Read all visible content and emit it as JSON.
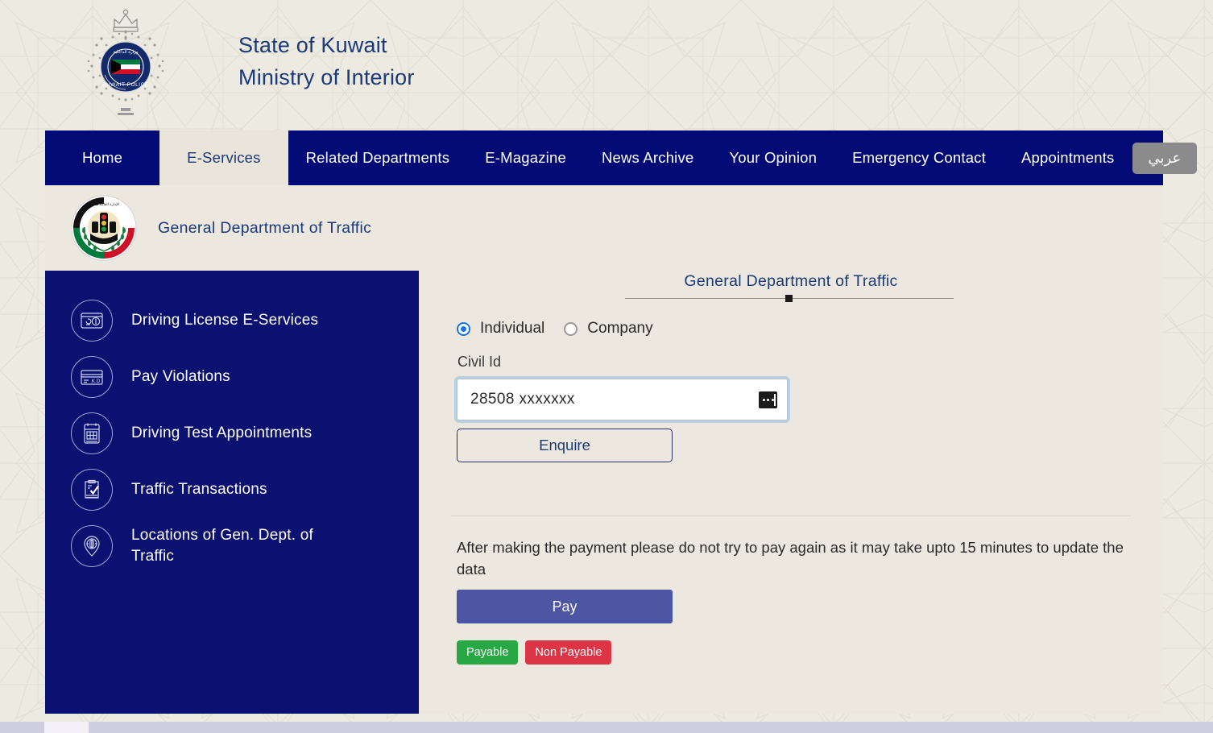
{
  "header": {
    "logo_icon": "kuwait-police-emblem",
    "line1": "State of Kuwait",
    "line2": "Ministry of Interior"
  },
  "nav": {
    "items": [
      {
        "label": "Home",
        "active": false
      },
      {
        "label": "E-Services",
        "active": true
      },
      {
        "label": "Related Departments",
        "active": false
      },
      {
        "label": "E-Magazine",
        "active": false
      },
      {
        "label": "News Archive",
        "active": false
      },
      {
        "label": "Your Opinion",
        "active": false
      },
      {
        "label": "Emergency Contact",
        "active": false
      },
      {
        "label": "Appointments",
        "active": false
      }
    ],
    "lang_button": "عربي",
    "bg_color": "#020a76",
    "active_bg_color": "#e9e5da"
  },
  "department": {
    "logo_icon": "general-department-of-traffic-emblem",
    "name": "General Department of Traffic"
  },
  "sidebar": {
    "bg_color": "#0b1170",
    "items": [
      {
        "label": "Driving License E-Services",
        "icon": "license-card-icon"
      },
      {
        "label": "Pay Violations",
        "icon": "payment-card-kd-icon"
      },
      {
        "label": "Driving Test Appointments",
        "icon": "calendar-icon"
      },
      {
        "label": " Traffic Transactions",
        "icon": "document-check-icon"
      },
      {
        "label": " Locations of Gen. Dept. of Traffic",
        "icon": "location-pin-icon"
      }
    ]
  },
  "main": {
    "section_title": "General Department of Traffic",
    "entity_type": {
      "options": [
        {
          "label": "Individual",
          "selected": true
        },
        {
          "label": "Company",
          "selected": false
        }
      ]
    },
    "civil_id": {
      "label": "Civil Id",
      "value": "28508 xxxxxxx",
      "placeholder": "Civil Id",
      "trailing_icon": "password-keyboard-icon"
    },
    "enquire_button": "Enquire",
    "payment_note": "After making the payment please do not try to pay again as it may take upto 15 minutes to update the data",
    "pay_button": "Pay",
    "pay_button_color": "#4d55a5",
    "legend": [
      {
        "label": "Payable",
        "color": "#28a745"
      },
      {
        "label": "Non Payable",
        "color": "#dc3545"
      }
    ]
  }
}
